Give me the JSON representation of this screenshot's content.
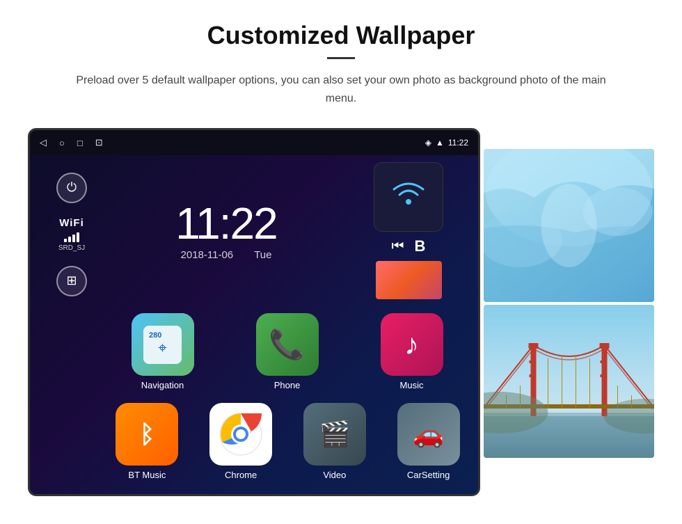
{
  "page": {
    "title": "Customized Wallpaper",
    "description": "Preload over 5 default wallpaper options, you can also set your own photo as background photo of the main menu."
  },
  "device": {
    "clock": {
      "time": "11:22",
      "date": "2018-11-06",
      "day": "Tue"
    },
    "status_bar": {
      "time": "11:22",
      "icons": [
        "location",
        "wifi",
        "signal"
      ]
    },
    "wifi": {
      "label": "WiFi",
      "ssid": "SRD_SJ"
    },
    "apps": [
      {
        "id": "navigation",
        "label": "Navigation",
        "badge": "280"
      },
      {
        "id": "phone",
        "label": "Phone"
      },
      {
        "id": "music",
        "label": "Music"
      },
      {
        "id": "bt-music",
        "label": "BT Music"
      },
      {
        "id": "chrome",
        "label": "Chrome"
      },
      {
        "id": "video",
        "label": "Video"
      },
      {
        "id": "carsetting",
        "label": "CarSetting"
      }
    ]
  }
}
